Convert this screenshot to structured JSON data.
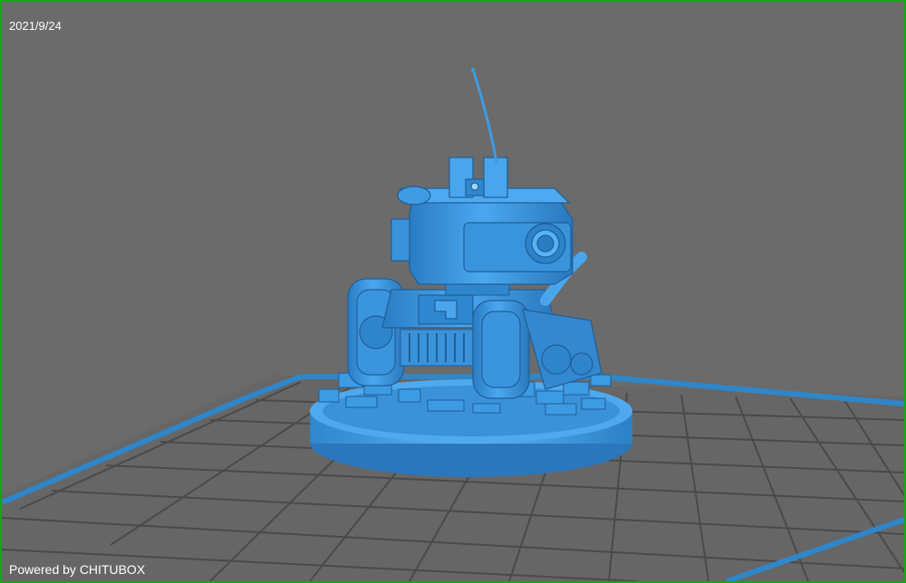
{
  "app": {
    "name": "CHITUBOX"
  },
  "overlay": {
    "date": "2021/9/24",
    "watermark": "Powered by CHITUBOX"
  },
  "scene": {
    "model": "tank-robot-miniature",
    "plate": "build-plate-grid"
  },
  "colors": {
    "background": "#6b6b6b",
    "frame": "#1aa31a",
    "model": "#3d9be4",
    "plate_edge": "#2f86c9",
    "grid": "#4c4c4c"
  }
}
